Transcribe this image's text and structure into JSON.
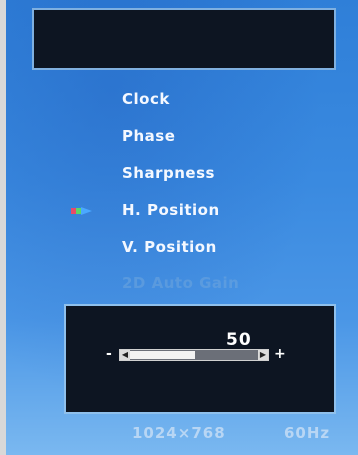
{
  "menu": {
    "items": [
      {
        "label": "Clock"
      },
      {
        "label": "Phase"
      },
      {
        "label": "Sharpness"
      },
      {
        "label": "H. Position"
      },
      {
        "label": "V. Position"
      },
      {
        "label": "2D Auto Gain"
      }
    ],
    "selected_index": 3
  },
  "adjustment": {
    "value_text": "50",
    "minus_label": "-",
    "plus_label": "+",
    "value": 50,
    "min": 0,
    "max": 100
  },
  "status": {
    "resolution": "1024×768",
    "refresh_rate": "60Hz"
  },
  "colors": {
    "background_top": "#2f7fd8",
    "background_bottom": "#7ab8f0",
    "panel": "#0d1522",
    "text": "#f4f8ff"
  }
}
